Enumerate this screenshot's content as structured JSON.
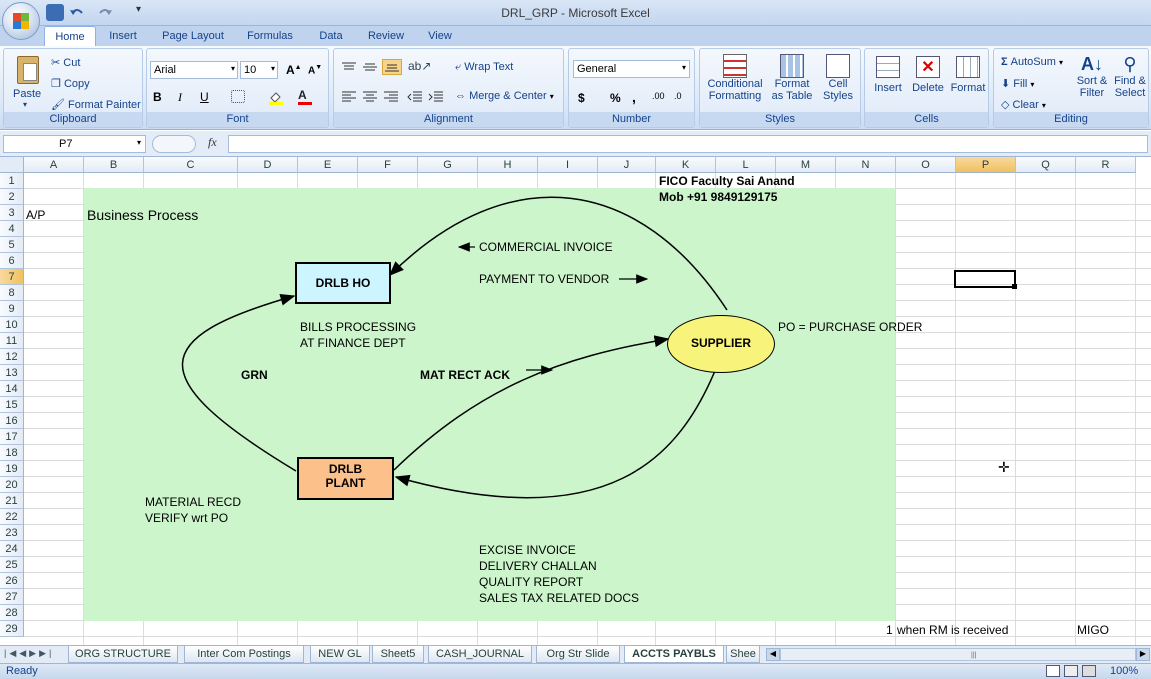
{
  "window": {
    "title": "DRL_GRP - Microsoft Excel"
  },
  "tabs": [
    "Home",
    "Insert",
    "Page Layout",
    "Formulas",
    "Data",
    "Review",
    "View"
  ],
  "ribbon": {
    "clipboard": {
      "paste": "Paste",
      "cut": "Cut",
      "copy": "Copy",
      "format_painter": "Format Painter",
      "label": "Clipboard"
    },
    "font": {
      "name": "Arial",
      "size": "10",
      "bold": "B",
      "italic": "I",
      "underline": "U",
      "label": "Font"
    },
    "alignment": {
      "wrap": "Wrap Text",
      "merge": "Merge & Center",
      "label": "Alignment"
    },
    "number": {
      "format": "General",
      "currency": "$",
      "percent": "%",
      "comma": ",",
      "label": "Number"
    },
    "styles": {
      "conditional": "Conditional",
      "conditional2": "Formatting",
      "format_table": "Format",
      "format_table2": "as Table",
      "cell_styles": "Cell",
      "cell_styles2": "Styles",
      "label": "Styles"
    },
    "cells": {
      "insert": "Insert",
      "delete": "Delete",
      "format": "Format",
      "label": "Cells"
    },
    "editing": {
      "autosum": "AutoSum",
      "fill": "Fill",
      "clear": "Clear",
      "sort": "Sort &",
      "sort2": "Filter",
      "find": "Find &",
      "find2": "Select",
      "label": "Editing"
    }
  },
  "formula_bar": {
    "name_box": "P7",
    "fx": "fx",
    "value": ""
  },
  "columns": [
    "A",
    "B",
    "C",
    "D",
    "E",
    "F",
    "G",
    "H",
    "I",
    "J",
    "K",
    "L",
    "M",
    "N",
    "O",
    "P",
    "Q",
    "R"
  ],
  "rows": [
    "1",
    "2",
    "3",
    "4",
    "5",
    "6",
    "7",
    "8",
    "9",
    "10",
    "11",
    "12",
    "13",
    "14",
    "15",
    "16",
    "17",
    "18",
    "19",
    "20",
    "21",
    "22",
    "23",
    "24",
    "25",
    "26",
    "27",
    "28",
    "29"
  ],
  "cells": {
    "a3": "A/P",
    "b3": "Business Process",
    "k1": "FICO Faculty Sai Anand",
    "k2": "Mob +91 9849129175",
    "n29": "1",
    "o29": "when RM is received",
    "r29": "MIGO"
  },
  "diagram": {
    "ho": "DRLB HO",
    "plant_line1": "DRLB",
    "plant_line2": "PLANT",
    "supplier": "SUPPLIER",
    "commercial_invoice": "COMMERCIAL INVOICE",
    "payment": "PAYMENT TO VENDOR",
    "bills1": "BILLS PROCESSING",
    "bills2": "AT FINANCE DEPT",
    "po": "PO = PURCHASE ORDER",
    "grn": "GRN",
    "mat_rect": "MAT RECT ACK",
    "material1": "MATERIAL RECD",
    "material2": "VERIFY wrt PO",
    "docs": [
      "EXCISE INVOICE",
      "DELIVERY CHALLAN",
      "QUALITY REPORT",
      "SALES TAX RELATED DOCS"
    ],
    "colors": {
      "ho_fill": "#ccf5ff",
      "plant_fill": "#fcc08a",
      "supplier_fill": "#f8f37a",
      "background": "#ccf5cc"
    }
  },
  "sheet_tabs": [
    "ORG STRUCTURE",
    "Inter Com Postings",
    "NEW GL",
    "Sheet5",
    "CASH_JOURNAL",
    "Org Str Slide",
    "ACCTS PAYBLS",
    "Shee"
  ],
  "active_sheet": "ACCTS PAYBLS",
  "status": {
    "ready": "Ready",
    "zoom": "100%"
  }
}
